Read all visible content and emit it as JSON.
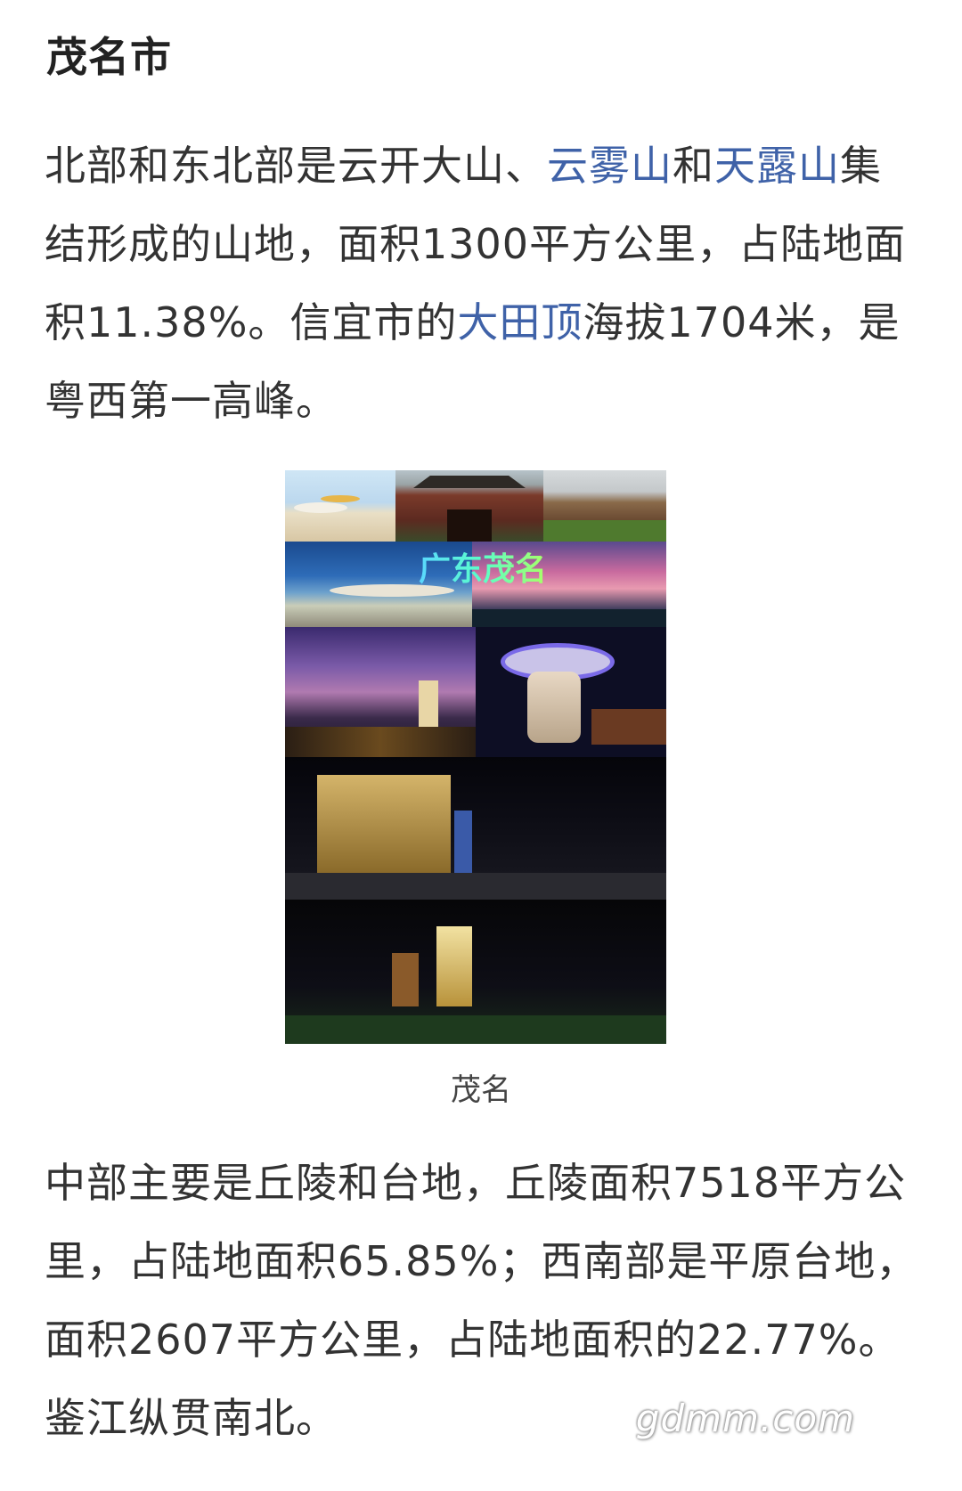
{
  "heading": "茂名市",
  "paragraph1": {
    "a": "北部和东北部是云开大山、",
    "link1": "云雾山",
    "b": "和",
    "link2": "天露山",
    "c": "集结形成的山地，面积1300平方公里，占陆地面积11.38%。信宜市的",
    "link3": "大田顶",
    "d": "海拔1704米，是粤西第一高峰。"
  },
  "figure": {
    "overlay_text": "广东茂名",
    "caption": "茂名"
  },
  "paragraph2": "中部主要是丘陵和台地，丘陵面积7518平方公里，占陆地面积65.85%；西南部是平原台地，面积2607平方公里，占陆地面积的22.77%。鉴江纵贯南北。",
  "watermark": "gdmm.com",
  "colors": {
    "link": "#3f62a8",
    "text": "#333333"
  }
}
